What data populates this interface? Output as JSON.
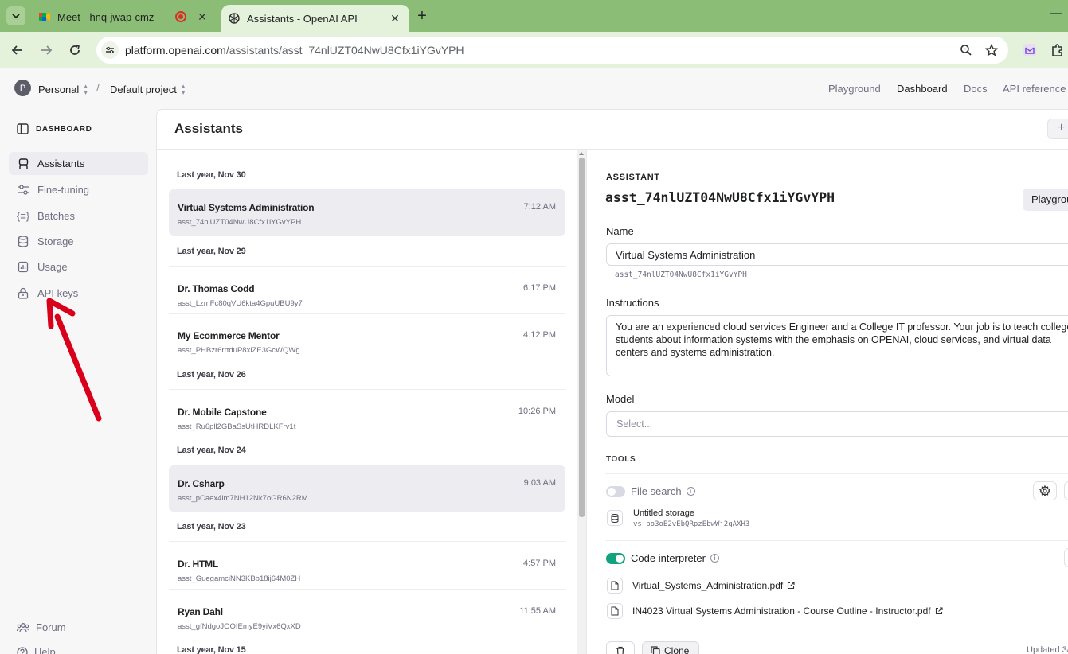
{
  "browser": {
    "tabs": [
      {
        "label": "Meet - hnq-jwap-cmz",
        "active": false
      },
      {
        "label": "Assistants - OpenAI API",
        "active": true
      }
    ],
    "url_host": "platform.openai.com",
    "url_path": "/assistants/asst_74nlUZT04NwU8Cfx1iYGvYPH"
  },
  "header": {
    "org_initial": "P",
    "org": "Personal",
    "project": "Default project",
    "nav": [
      "Playground",
      "Dashboard",
      "Docs",
      "API reference"
    ]
  },
  "sidebar": {
    "title": "DASHBOARD",
    "items": [
      {
        "label": "Assistants",
        "icon": "robot-icon"
      },
      {
        "label": "Fine-tuning",
        "icon": "sliders-icon"
      },
      {
        "label": "Batches",
        "icon": "braces-icon"
      },
      {
        "label": "Storage",
        "icon": "database-icon"
      },
      {
        "label": "Usage",
        "icon": "chart-icon"
      },
      {
        "label": "API keys",
        "icon": "lock-icon"
      }
    ],
    "footer": [
      "Forum",
      "Help"
    ]
  },
  "main": {
    "title": "Assistants",
    "create_label": "+"
  },
  "list": {
    "groups": [
      {
        "label": "Last year, Nov 30",
        "items": [
          {
            "name": "Virtual Systems Administration",
            "id": "asst_74nlUZT04NwU8Cfx1iYGvYPH",
            "time": "7:12 AM"
          }
        ]
      },
      {
        "label": "Last year, Nov 29",
        "items": [
          {
            "name": "Dr. Thomas Codd",
            "id": "asst_LzmFc80qVU6kta4GpuUBU9y7",
            "time": "6:17 PM"
          },
          {
            "name": "My Ecommerce Mentor",
            "id": "asst_PHBzr6rrtduP8xlZE3GcWQWg",
            "time": "4:12 PM"
          }
        ]
      },
      {
        "label": "Last year, Nov 26",
        "items": [
          {
            "name": "Dr. Mobile Capstone",
            "id": "asst_Ru6pll2GBaSsUtHRDLKFrv1t",
            "time": "10:26 PM"
          }
        ]
      },
      {
        "label": "Last year, Nov 24",
        "items": [
          {
            "name": "Dr. Csharp",
            "id": "asst_pCaex4im7NH12Nk7oGR6N2RM",
            "time": "9:03 AM"
          }
        ]
      },
      {
        "label": "Last year, Nov 23",
        "items": [
          {
            "name": "Dr. HTML",
            "id": "asst_GuegamciNN3KBb18ij64M0ZH",
            "time": "4:57 PM"
          },
          {
            "name": "Ryan Dahl",
            "id": "asst_gfNdgoJOOIEmyE9yiVx6QxXD",
            "time": "11:55 AM"
          }
        ]
      },
      {
        "label": "Last year, Nov 15",
        "items": []
      }
    ]
  },
  "detail": {
    "section_label": "ASSISTANT",
    "id": "asst_74nlUZT04NwU8Cfx1iYGvYPH",
    "playground_label": "Playground",
    "name_label": "Name",
    "name_value": "Virtual Systems Administration",
    "name_sub_id": "asst_74nlUZT04NwU8Cfx1iYGvYPH",
    "instructions_label": "Instructions",
    "instructions": "You are an experienced cloud services Engineer and a College IT professor. Your job is to teach college students about information systems with the emphasis on OPENAI, cloud services, and virtual data centers and systems administration.",
    "model_label": "Model",
    "model_placeholder": "Select...",
    "tools_label": "TOOLS",
    "file_search_label": "File search",
    "storage_name": "Untitled storage",
    "storage_id": "vs_po3oE2vEbQRpzEbwWj2qAXH3",
    "code_interpreter_label": "Code interpreter",
    "files": [
      "Virtual_Systems_Administration.pdf",
      "IN4023 Virtual Systems Administration - Course Outline - Instructor.pdf"
    ],
    "clone_label": "Clone",
    "updated": "Updated 3/"
  },
  "colors": {
    "tabbar": "#8cbd77",
    "accent_green": "#10a37f",
    "arrow_red": "#d9001b"
  }
}
